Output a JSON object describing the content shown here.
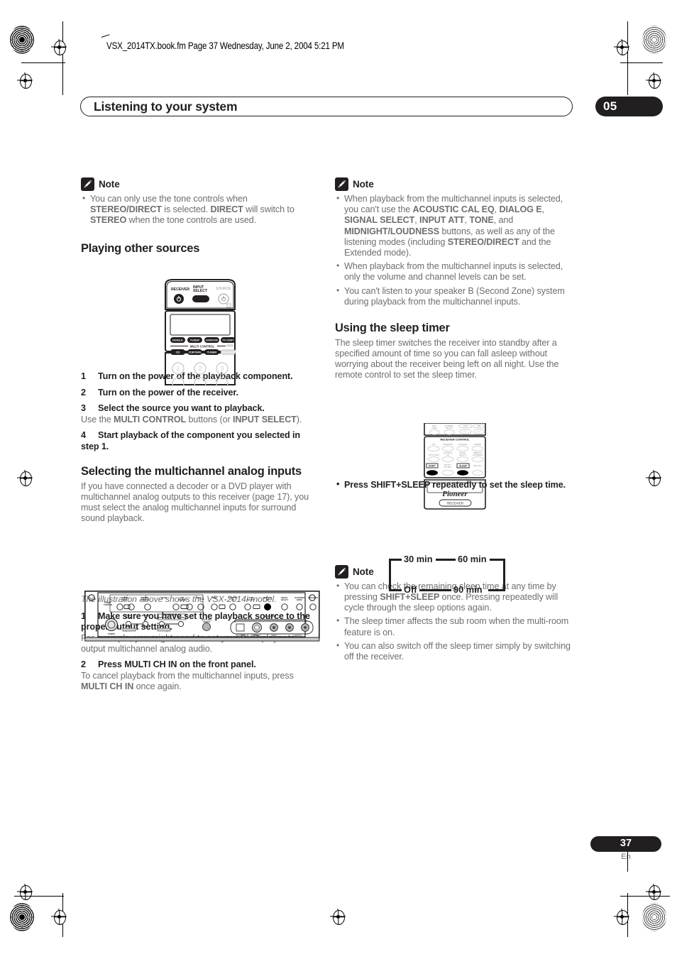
{
  "header": {
    "file_stamp": "VSX_2014TX.book.fm  Page 37  Wednesday, June 2, 2004  5:21 PM",
    "chapter_title": "Listening to your system",
    "chapter_number": "05"
  },
  "footer": {
    "page_number": "37",
    "language": "En"
  },
  "left_column": {
    "note1": {
      "title": "Note",
      "items": [
        "You can only use the tone controls when <b>STEREO/DIRECT</b> is selected. <b>DIRECT</b> will switch to <b>STEREO</b> when the tone controls are used."
      ]
    },
    "heading_playing": "Playing other sources",
    "steps_playing": [
      {
        "n": "1",
        "title": "Turn on the power of the playback component.",
        "sub": ""
      },
      {
        "n": "2",
        "title": "Turn on the power of the receiver.",
        "sub": ""
      },
      {
        "n": "3",
        "title": "Select the source you want to playback.",
        "sub": "Use the <b>MULTI CONTROL</b> buttons (or <b>INPUT SELECT</b>)."
      },
      {
        "n": "4",
        "title": "Start playback of the component you selected in step 1.",
        "sub": ""
      }
    ],
    "heading_multich": "Selecting the multichannel analog inputs",
    "multich_intro": "If you have connected a decoder or a DVD player with multichannel analog outputs to this receiver (page 17), you must select the analog multichannel inputs for surround sound playback.",
    "panel_caption": "The illustration above shows the VSX-2014i model.",
    "steps_multich": [
      {
        "n": "1",
        "title": "Make sure you have set the playback source to the proper output setting.",
        "sub": "For example, you might need to set your DVD player to output multichannel analog audio."
      },
      {
        "n": "2",
        "title": "Press MULTI CH IN on the front panel.",
        "sub": "To cancel playback from the multichannel inputs, press <b>MULTI CH IN</b> once again."
      }
    ]
  },
  "right_column": {
    "note2": {
      "title": "Note",
      "items": [
        "When playback from the multichannel inputs is selected, you can't use the <b>ACOUSTIC CAL EQ</b>, <b>DIALOG E</b>, <b>SIGNAL SELECT</b>, <b>INPUT ATT</b>, <b>TONE</b>, and <b>MIDNIGHT/LOUDNESS</b> buttons, as well as any of the listening modes (including <b>STEREO/DIRECT</b> and the Extended mode).",
        "When playback from the multichannel inputs is selected, only the volume and channel levels can be set.",
        "You can't listen to your speaker B (Second Zone) system during playback from the multichannel inputs."
      ]
    },
    "heading_sleep": "Using the sleep timer",
    "sleep_intro": "The sleep timer switches the receiver into standby after a specified amount of time so you can fall asleep without worrying about the receiver being left on all night. Use the remote control to set the sleep timer.",
    "sleep_step": "Press SHIFT+SLEEP repeatedly to set the sleep time.",
    "sleep_cycle": {
      "top_left": "30 min",
      "top_right": "60 min",
      "bottom_left": "Off",
      "bottom_right": "90 min"
    },
    "note3": {
      "title": "Note",
      "items": [
        "You can check the remaining sleep time at any time by pressing <b>SHIFT+SLEEP</b> once. Pressing repeatedly will cycle through the sleep options again.",
        "The sleep timer affects the sub room when the multi-room feature is on.",
        "You can also switch off the sleep timer simply by switching off the receiver."
      ]
    }
  },
  "illustrations": {
    "remote_top": {
      "labels": {
        "receiver": "RECEIVER",
        "input_select": "INPUT SELECT",
        "source": "SOURCE",
        "multi_control": "MULTI CONTROL"
      },
      "source_buttons_row1": [
        "DVD/LD",
        "TV/SAT",
        "DVR/VCR",
        "TV CONT"
      ],
      "source_buttons_row2": [
        "CD",
        "CDR/TAPE",
        "TUNER",
        "RECEIVER"
      ],
      "number_buttons": [
        "1",
        "2",
        "3"
      ]
    },
    "remote_sleep": {
      "labels": {
        "receiver_control": "RECEIVER CONTROL",
        "brand": "Pioneer",
        "mode": "RECEIVER"
      },
      "top_row": [
        "MPX AUDIO",
        "CHANNEL SELECT",
        "FL/D",
        "DIM"
      ],
      "mode_buttons": [
        "THX",
        "STANDARD",
        "ADVANCED",
        "STEREO"
      ],
      "mode_buttons2": [
        "AUTO SURR",
        "ACOUSTIC EQ",
        "SIGNAL SELECT",
        "MIDNIGHT LOUDNESS"
      ],
      "bottom_row": [
        "SHIFT",
        "EFFECT (CH SEL)",
        "SLEEP",
        "DIALOG E"
      ],
      "highlighted": [
        "SHIFT",
        "SLEEP"
      ]
    },
    "front_panel": {
      "group_tuner": "TUNER CONTROL",
      "top_labels": [
        "TUNER EDIT",
        "TUNING STATION",
        "BAND",
        "PTY SEARCH",
        "EON",
        "TONE",
        "ACOUSTIC EQ",
        "LOUD SELECT",
        "MULTI CH IN",
        "SIGNAL SELECT",
        "EXTENDED MODE",
        "SPEAKERS"
      ],
      "mid_labels": [
        "SYSTEM SETUP",
        "RETURN",
        "MULTI ROOM",
        "CONTROL",
        "ON/OFF",
        "MULTI JOG/ENTER",
        "VIDEO INPUT"
      ],
      "jack_labels": [
        "DIGITAL IN",
        "S-VIDEO",
        "VIDEO",
        "L  AUDIO  R"
      ],
      "power_label": "POWER",
      "highlighted_control": "MULTI CH IN"
    }
  },
  "colors": {
    "ink_black": "#231f20",
    "body_gray": "#6d6e71",
    "paper": "#ffffff"
  }
}
